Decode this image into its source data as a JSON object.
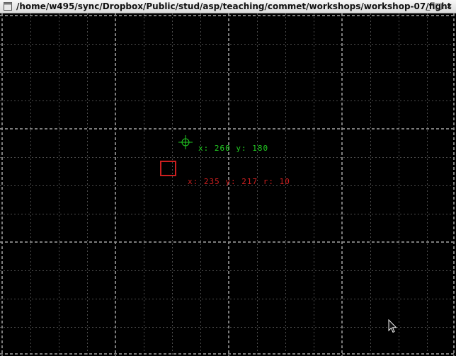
{
  "window": {
    "title": "/home/w495/sync/Dropbox/Public/stud/asp/teaching/commet/workshops/workshop-07/fight",
    "minimize_glyph": "_",
    "maximize_glyph": "□",
    "close_glyph": "×"
  },
  "scene": {
    "background": "#000000",
    "grid_color": "#8a8a8a",
    "target": {
      "color": "#22cc22",
      "label": "x: 260 y: 180"
    },
    "box": {
      "color": "#cc1f1f",
      "label": "x: 235 y: 217 r: 10"
    }
  }
}
